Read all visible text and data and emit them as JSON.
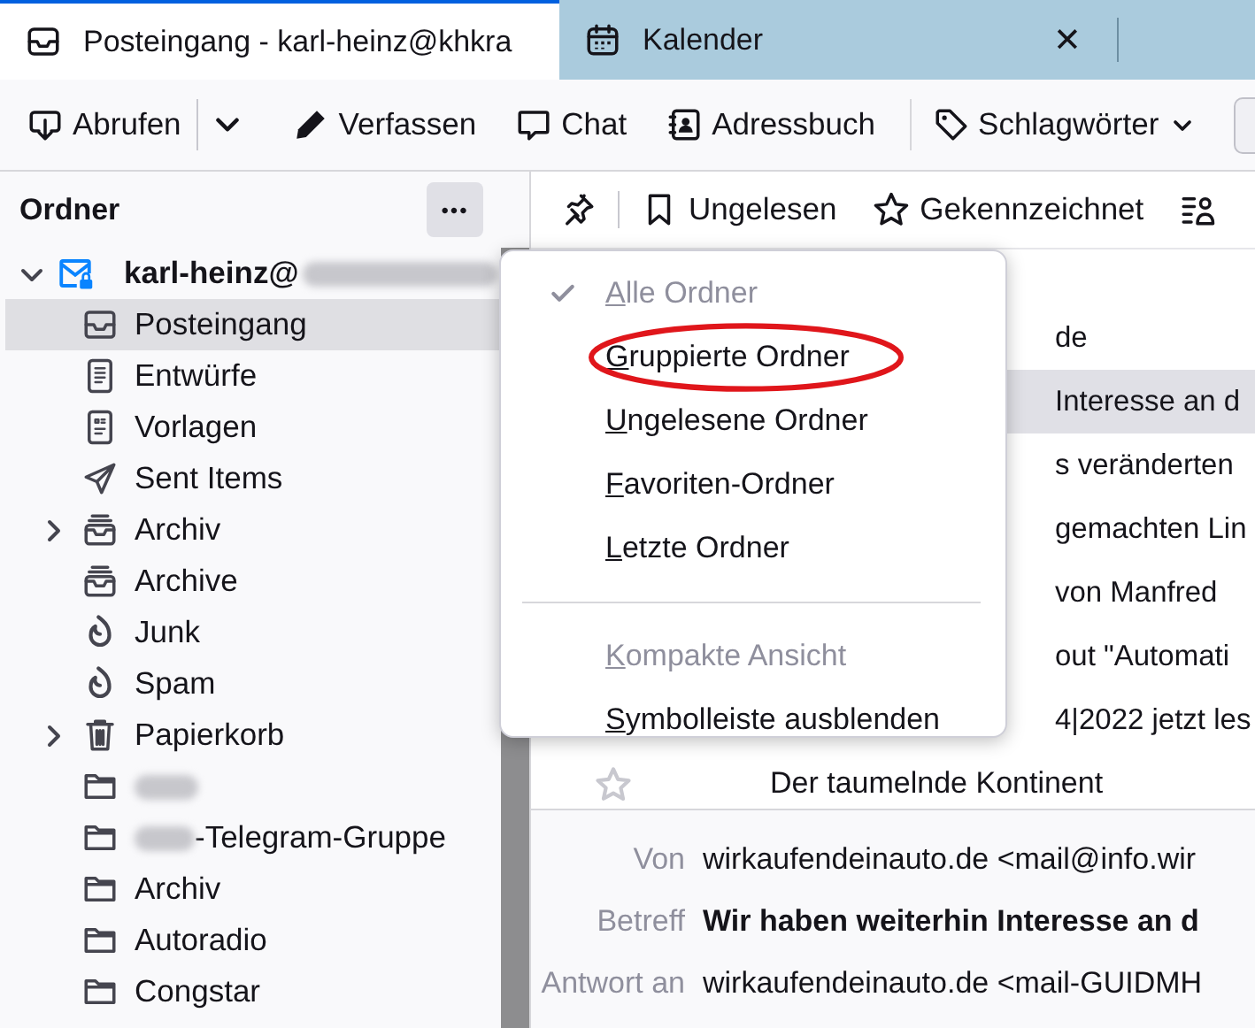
{
  "tabs": [
    {
      "title": "Posteingang - karl-heinz@khkra",
      "kind": "mail",
      "selected": true,
      "closable": false
    },
    {
      "title": "Kalender",
      "kind": "calendar",
      "selected": false,
      "closable": true
    }
  ],
  "close_glyph": "✕",
  "toolbar": [
    {
      "kind": "download",
      "label": "Abrufen"
    },
    {
      "kind": "dropdown"
    },
    {
      "kind": "pencil",
      "label": "Verfassen"
    },
    {
      "kind": "chat",
      "label": "Chat"
    },
    {
      "kind": "addressbook",
      "label": "Adressbuch"
    },
    {
      "kind": "tag",
      "label": "Schlagwörter"
    }
  ],
  "folder_pane": {
    "title": "Ordner",
    "more_button": "•••",
    "account": {
      "name": "karl-heinz@",
      "redacted": true,
      "expanded": true
    },
    "folders": [
      {
        "kind": "inbox",
        "label": "Posteingang",
        "selected": true,
        "collapsed": false,
        "redacted": false
      },
      {
        "kind": "drafts",
        "label": "Entwürfe",
        "selected": false,
        "collapsed": false,
        "redacted": false
      },
      {
        "kind": "templates",
        "label": "Vorlagen",
        "selected": false,
        "collapsed": false,
        "redacted": false
      },
      {
        "kind": "sent",
        "label": "Sent Items",
        "selected": false,
        "collapsed": false,
        "redacted": false
      },
      {
        "kind": "archive",
        "label": "Archiv",
        "selected": false,
        "collapsed": true,
        "redacted": false
      },
      {
        "kind": "archive",
        "label": "Archive",
        "selected": false,
        "collapsed": false,
        "redacted": false
      },
      {
        "kind": "junk",
        "label": "Junk",
        "selected": false,
        "collapsed": false,
        "redacted": false
      },
      {
        "kind": "junk",
        "label": "Spam",
        "selected": false,
        "collapsed": false,
        "redacted": false
      },
      {
        "kind": "trash",
        "label": "Papierkorb",
        "selected": false,
        "collapsed": true,
        "redacted": false
      },
      {
        "kind": "folder",
        "selected": false,
        "collapsed": false,
        "redacted": true
      },
      {
        "kind": "folder",
        "label": "-Telegram-Gruppe",
        "selected": false,
        "collapsed": false,
        "redacted": true
      },
      {
        "kind": "folder",
        "label": "Archiv",
        "selected": false,
        "collapsed": false,
        "redacted": false
      },
      {
        "kind": "folder",
        "label": "Autoradio",
        "selected": false,
        "collapsed": false,
        "redacted": false
      },
      {
        "kind": "folder",
        "label": "Congstar",
        "selected": false,
        "collapsed": false,
        "redacted": false
      }
    ]
  },
  "quick_filter": [
    {
      "kind": "pin"
    },
    {
      "kind": "bookmark",
      "label": "Ungelesen"
    },
    {
      "kind": "star",
      "label": "Gekennzeichnet"
    },
    {
      "kind": "contact"
    }
  ],
  "messages": [
    {
      "kind": "covered",
      "subject": "de",
      "selected": false
    },
    {
      "kind": "covered",
      "subject": "Interesse an d",
      "selected": true
    },
    {
      "kind": "covered",
      "subject": "s veränderten",
      "selected": false
    },
    {
      "kind": "covered",
      "subject": "gemachten Lin",
      "selected": false
    },
    {
      "kind": "covered",
      "subject": "von Manfred",
      "selected": false
    },
    {
      "kind": "covered",
      "subject": "out \"Automati",
      "selected": false
    },
    {
      "kind": "covered",
      "subject": "4|2022 jetzt les",
      "selected": false
    },
    {
      "kind": "full",
      "subject": "Der taumelnde Kontinent",
      "selected": false
    }
  ],
  "message_header": [
    {
      "label": "Von",
      "value": "wirkaufendeinauto.de <mail@info.wir",
      "kind": "plain"
    },
    {
      "label": "Betreff",
      "value": "Wir haben weiterhin Interesse an d",
      "kind": "subject"
    },
    {
      "label": "Antwort an",
      "value": "wirkaufendeinauto.de <mail-GUIDMH",
      "kind": "plain"
    }
  ],
  "menu": [
    {
      "kind": "item",
      "label": "Alle Ordner",
      "checked": true,
      "disabled": true,
      "highlighted": false
    },
    {
      "kind": "item",
      "label": "Gruppierte Ordner",
      "checked": false,
      "disabled": false,
      "highlighted": true
    },
    {
      "kind": "item",
      "label": "Ungelesene Ordner",
      "checked": false,
      "disabled": false,
      "highlighted": false
    },
    {
      "kind": "item",
      "label": "Favoriten-Ordner",
      "checked": false,
      "disabled": false,
      "highlighted": false
    },
    {
      "kind": "item",
      "label": "Letzte Ordner",
      "checked": false,
      "disabled": false,
      "highlighted": false
    },
    {
      "kind": "separator"
    },
    {
      "kind": "item",
      "label": "Kompakte Ansicht",
      "checked": false,
      "disabled": true,
      "highlighted": false
    },
    {
      "kind": "item",
      "label": "Symbolleiste ausblenden",
      "checked": false,
      "disabled": false,
      "highlighted": false
    }
  ]
}
